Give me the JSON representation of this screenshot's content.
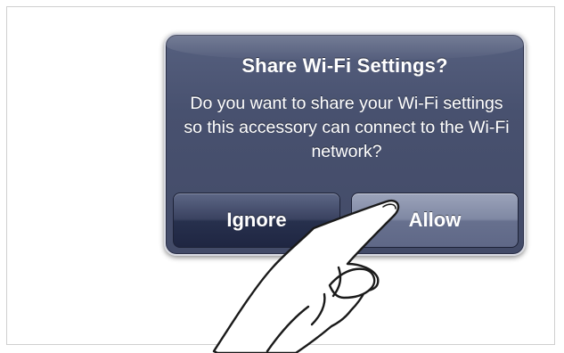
{
  "alert": {
    "title": "Share Wi-Fi Settings?",
    "message": "Do you want to share your Wi-Fi settings so this accessory can connect to the Wi-Fi network?",
    "buttons": {
      "ignore_label": "Ignore",
      "allow_label": "Allow"
    }
  },
  "overlay": {
    "icon": "pointing-hand-icon"
  },
  "colors": {
    "alert_background": "#48516f",
    "alert_border": "#d9dbe3",
    "ignore_button": "#27304d",
    "allow_button": "#7f88a3",
    "text": "#ffffff"
  }
}
